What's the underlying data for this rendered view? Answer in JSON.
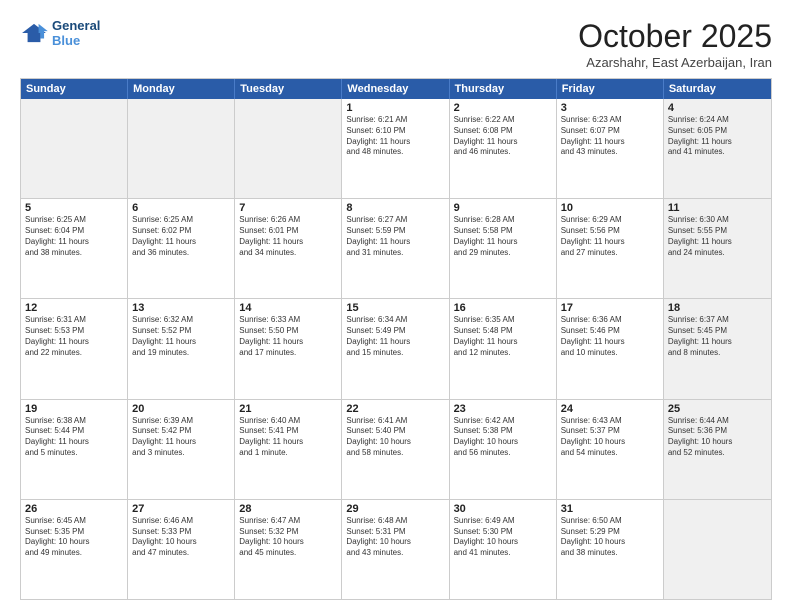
{
  "logo": {
    "line1": "General",
    "line2": "Blue"
  },
  "title": "October 2025",
  "location": "Azarshahr, East Azerbaijan, Iran",
  "header_days": [
    "Sunday",
    "Monday",
    "Tuesday",
    "Wednesday",
    "Thursday",
    "Friday",
    "Saturday"
  ],
  "weeks": [
    [
      {
        "day": "",
        "info": "",
        "shaded": true
      },
      {
        "day": "",
        "info": "",
        "shaded": true
      },
      {
        "day": "",
        "info": "",
        "shaded": true
      },
      {
        "day": "1",
        "info": "Sunrise: 6:21 AM\nSunset: 6:10 PM\nDaylight: 11 hours\nand 48 minutes."
      },
      {
        "day": "2",
        "info": "Sunrise: 6:22 AM\nSunset: 6:08 PM\nDaylight: 11 hours\nand 46 minutes."
      },
      {
        "day": "3",
        "info": "Sunrise: 6:23 AM\nSunset: 6:07 PM\nDaylight: 11 hours\nand 43 minutes."
      },
      {
        "day": "4",
        "info": "Sunrise: 6:24 AM\nSunset: 6:05 PM\nDaylight: 11 hours\nand 41 minutes.",
        "shaded": true
      }
    ],
    [
      {
        "day": "5",
        "info": "Sunrise: 6:25 AM\nSunset: 6:04 PM\nDaylight: 11 hours\nand 38 minutes."
      },
      {
        "day": "6",
        "info": "Sunrise: 6:25 AM\nSunset: 6:02 PM\nDaylight: 11 hours\nand 36 minutes."
      },
      {
        "day": "7",
        "info": "Sunrise: 6:26 AM\nSunset: 6:01 PM\nDaylight: 11 hours\nand 34 minutes."
      },
      {
        "day": "8",
        "info": "Sunrise: 6:27 AM\nSunset: 5:59 PM\nDaylight: 11 hours\nand 31 minutes."
      },
      {
        "day": "9",
        "info": "Sunrise: 6:28 AM\nSunset: 5:58 PM\nDaylight: 11 hours\nand 29 minutes."
      },
      {
        "day": "10",
        "info": "Sunrise: 6:29 AM\nSunset: 5:56 PM\nDaylight: 11 hours\nand 27 minutes."
      },
      {
        "day": "11",
        "info": "Sunrise: 6:30 AM\nSunset: 5:55 PM\nDaylight: 11 hours\nand 24 minutes.",
        "shaded": true
      }
    ],
    [
      {
        "day": "12",
        "info": "Sunrise: 6:31 AM\nSunset: 5:53 PM\nDaylight: 11 hours\nand 22 minutes."
      },
      {
        "day": "13",
        "info": "Sunrise: 6:32 AM\nSunset: 5:52 PM\nDaylight: 11 hours\nand 19 minutes."
      },
      {
        "day": "14",
        "info": "Sunrise: 6:33 AM\nSunset: 5:50 PM\nDaylight: 11 hours\nand 17 minutes."
      },
      {
        "day": "15",
        "info": "Sunrise: 6:34 AM\nSunset: 5:49 PM\nDaylight: 11 hours\nand 15 minutes."
      },
      {
        "day": "16",
        "info": "Sunrise: 6:35 AM\nSunset: 5:48 PM\nDaylight: 11 hours\nand 12 minutes."
      },
      {
        "day": "17",
        "info": "Sunrise: 6:36 AM\nSunset: 5:46 PM\nDaylight: 11 hours\nand 10 minutes."
      },
      {
        "day": "18",
        "info": "Sunrise: 6:37 AM\nSunset: 5:45 PM\nDaylight: 11 hours\nand 8 minutes.",
        "shaded": true
      }
    ],
    [
      {
        "day": "19",
        "info": "Sunrise: 6:38 AM\nSunset: 5:44 PM\nDaylight: 11 hours\nand 5 minutes."
      },
      {
        "day": "20",
        "info": "Sunrise: 6:39 AM\nSunset: 5:42 PM\nDaylight: 11 hours\nand 3 minutes."
      },
      {
        "day": "21",
        "info": "Sunrise: 6:40 AM\nSunset: 5:41 PM\nDaylight: 11 hours\nand 1 minute."
      },
      {
        "day": "22",
        "info": "Sunrise: 6:41 AM\nSunset: 5:40 PM\nDaylight: 10 hours\nand 58 minutes."
      },
      {
        "day": "23",
        "info": "Sunrise: 6:42 AM\nSunset: 5:38 PM\nDaylight: 10 hours\nand 56 minutes."
      },
      {
        "day": "24",
        "info": "Sunrise: 6:43 AM\nSunset: 5:37 PM\nDaylight: 10 hours\nand 54 minutes."
      },
      {
        "day": "25",
        "info": "Sunrise: 6:44 AM\nSunset: 5:36 PM\nDaylight: 10 hours\nand 52 minutes.",
        "shaded": true
      }
    ],
    [
      {
        "day": "26",
        "info": "Sunrise: 6:45 AM\nSunset: 5:35 PM\nDaylight: 10 hours\nand 49 minutes."
      },
      {
        "day": "27",
        "info": "Sunrise: 6:46 AM\nSunset: 5:33 PM\nDaylight: 10 hours\nand 47 minutes."
      },
      {
        "day": "28",
        "info": "Sunrise: 6:47 AM\nSunset: 5:32 PM\nDaylight: 10 hours\nand 45 minutes."
      },
      {
        "day": "29",
        "info": "Sunrise: 6:48 AM\nSunset: 5:31 PM\nDaylight: 10 hours\nand 43 minutes."
      },
      {
        "day": "30",
        "info": "Sunrise: 6:49 AM\nSunset: 5:30 PM\nDaylight: 10 hours\nand 41 minutes."
      },
      {
        "day": "31",
        "info": "Sunrise: 6:50 AM\nSunset: 5:29 PM\nDaylight: 10 hours\nand 38 minutes."
      },
      {
        "day": "",
        "info": "",
        "shaded": true
      }
    ]
  ]
}
